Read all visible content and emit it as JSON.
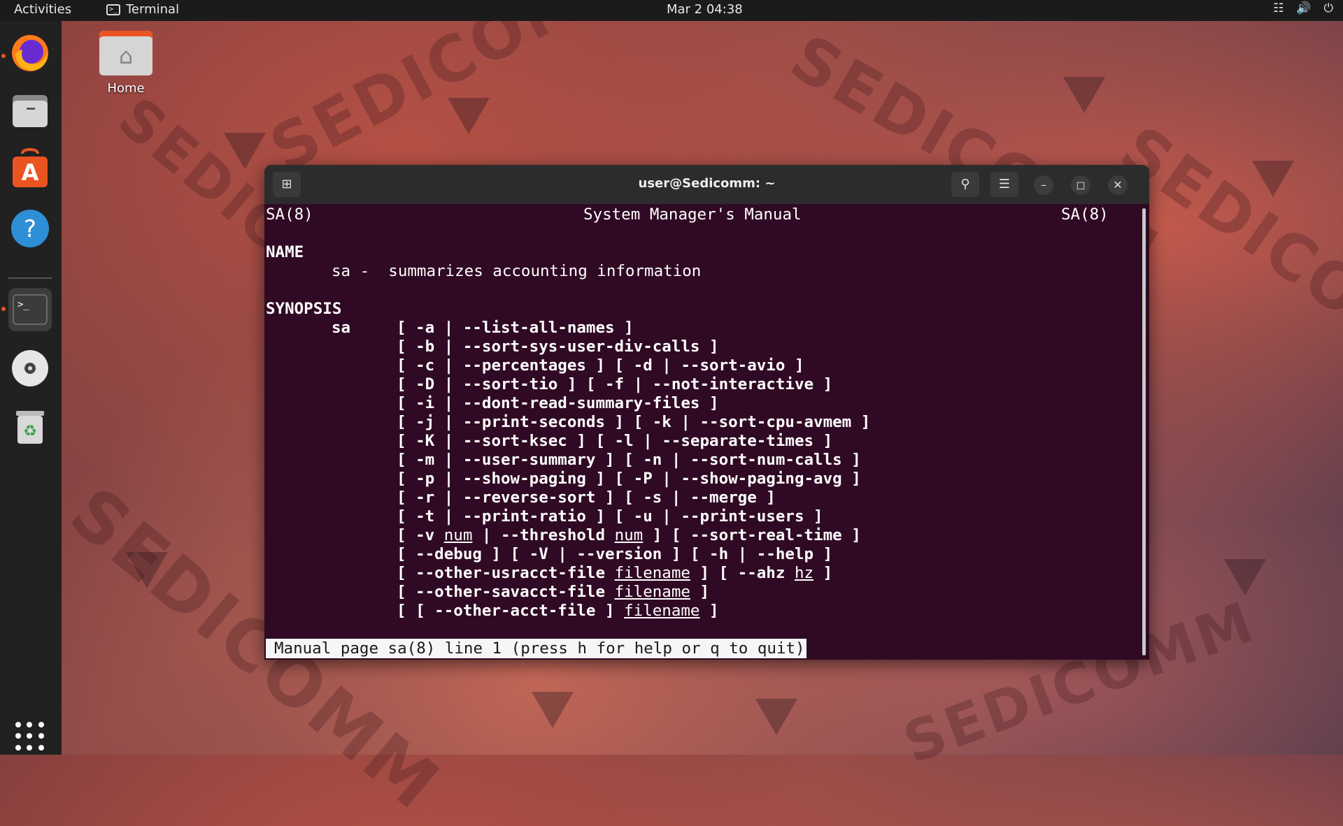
{
  "topbar": {
    "activities": "Activities",
    "app_name": "Terminal",
    "clock": "Mar 2  04:38"
  },
  "desktop": {
    "home_label": "Home",
    "watermark_text": "SEDICOMM"
  },
  "dock": {
    "items": [
      "firefox-icon",
      "files-icon",
      "software-icon",
      "help-icon",
      "terminal-icon",
      "disc-icon",
      "trash-icon"
    ]
  },
  "terminal": {
    "title": "user@Sedicomm: ~",
    "header_left": "SA(8)",
    "header_center": "System Manager's Manual",
    "header_right": "SA(8)",
    "name_heading": "NAME",
    "name_line": "sa -  summarizes accounting information",
    "synopsis_heading": "SYNOPSIS",
    "synopsis_cmd": "sa",
    "synopsis_lines": [
      "[ -a | --list-all-names ]",
      "[ -b | --sort-sys-user-div-calls ]",
      "[ -c | --percentages ] [ -d | --sort-avio ]",
      "[ -D | --sort-tio ] [ -f | --not-interactive ]",
      "[ -i | --dont-read-summary-files ]",
      "[ -j | --print-seconds ] [ -k | --sort-cpu-avmem ]",
      "[ -K | --sort-ksec ] [ -l | --separate-times ]",
      "[ -m | --user-summary ] [ -n | --sort-num-calls ]",
      "[ -p | --show-paging ] [ -P | --show-paging-avg ]",
      "[ -r | --reverse-sort ] [ -s | --merge ]",
      "[ -t | --print-ratio ] [ -u | --print-users ]"
    ],
    "line_v": {
      "a": "[ -v ",
      "u1": "num",
      "b": " | --threshold ",
      "u2": "num",
      "c": " ] [ --sort-real-time ]"
    },
    "line_debug": "[ --debug ] [ -V | --version ] [ -h | --help ]",
    "line_usracct": {
      "a": "[ --other-usracct-file ",
      "u1": "filename",
      "b": " ] [ --ahz ",
      "u2": "hz",
      "c": " ]"
    },
    "line_savacct": {
      "a": "[ --other-savacct-file ",
      "u1": "filename",
      "b": " ]"
    },
    "line_acct": {
      "a": "[ [ --other-acct-file ] ",
      "u1": "filename",
      "b": " ]"
    },
    "status": "Manual page sa(8) line 1 (press h for help or q to quit)"
  }
}
